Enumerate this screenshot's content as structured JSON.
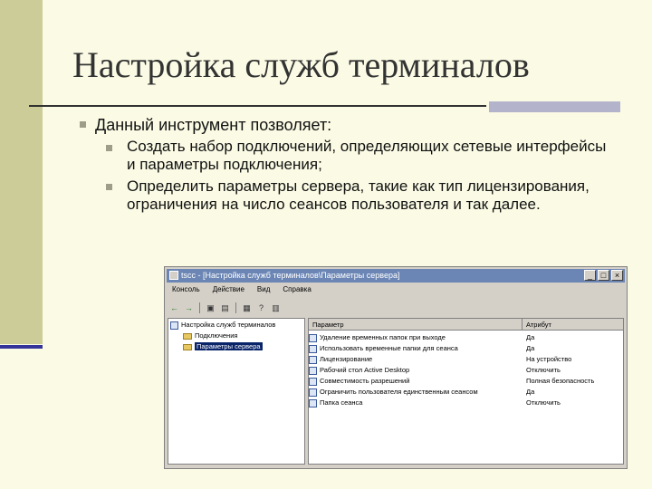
{
  "slide": {
    "title": "Настройка служб терминалов",
    "intro": "Данный инструмент позволяет:",
    "bullets": [
      "Создать набор подключений, определяющих сетевые интерфейсы и параметры подключения;",
      "Определить параметры сервера, такие как тип лицензирования, ограничения на число сеансов пользователя и так далее."
    ]
  },
  "window": {
    "title": "tscc - [Настройка служб терминалов\\Параметры сервера]",
    "menu": [
      "Консоль",
      "Действие",
      "Вид",
      "Справка"
    ],
    "tree": {
      "root": "Настройка служб терминалов",
      "children": [
        "Подключения",
        "Параметры сервера"
      ]
    },
    "columns": {
      "name": "Параметр",
      "attr": "Атрибут"
    },
    "rows": [
      {
        "name": "Удаление временных папок при выходе",
        "attr": "Да"
      },
      {
        "name": "Использовать временные папки для сеанса",
        "attr": "Да"
      },
      {
        "name": "Лицензирование",
        "attr": "На устройство"
      },
      {
        "name": "Рабочий стол Active Desktop",
        "attr": "Отключить"
      },
      {
        "name": "Совместимость разрешений",
        "attr": "Полная безопасность"
      },
      {
        "name": "Ограничить пользователя единственным сеансом",
        "attr": "Да"
      },
      {
        "name": "Папка сеанса",
        "attr": "Отключить"
      }
    ]
  }
}
